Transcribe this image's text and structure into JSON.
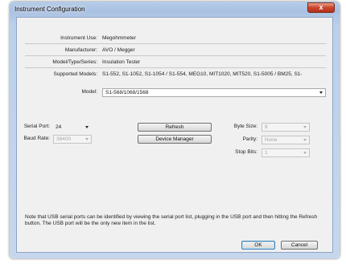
{
  "window": {
    "title": "Instrument Configuration",
    "close_glyph": "x"
  },
  "info": {
    "instrument_use_label": "Instrument Use:",
    "instrument_use_value": "Megohmmeter",
    "manufacturer_label": "Manufacturer:",
    "manufacturer_value": "AVO / Megger",
    "model_type_label": "Model/Type/Series:",
    "model_type_value": "Insulation Tester",
    "supported_models_label": "Supported Models:",
    "supported_models_value": "S1-552, S1-1052, S1-1054 / S1-554, MEG10, MIT1020, MIT520, S1-5005 / BM25, S1-"
  },
  "model": {
    "label": "Model:",
    "value": "S1-568/1068/1568"
  },
  "serial": {
    "port_label": "Serial Port:",
    "port_value": "24",
    "refresh_label": "Refresh",
    "baud_label": "Baud Rate:",
    "baud_value": "38400",
    "device_manager_label": "Device Manager",
    "byte_size_label": "Byte Size:",
    "byte_size_value": "8",
    "parity_label": "Parity:",
    "parity_value": "None",
    "stop_bits_label": "Stop Bits:",
    "stop_bits_value": "1"
  },
  "note_text": "Note that USB serial ports can be identified by viewing the serial port list, plugging in the USB port and then hitting the Refresh button.  The USB port will be the only new item in the list.",
  "footer": {
    "ok_label": "OK",
    "cancel_label": "Cancel"
  }
}
